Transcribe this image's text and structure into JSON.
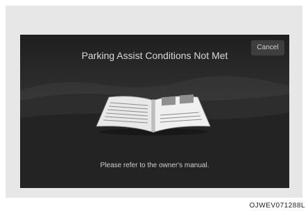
{
  "dialog": {
    "title": "Parking Assist Conditions Not Met",
    "cancel_label": "Cancel",
    "message": "Please refer to the owner's manual."
  },
  "icons": {
    "illustration": "open-book-icon"
  },
  "figure": {
    "code": "OJWEV071288L"
  },
  "colors": {
    "screen_dark": "#1f1f1f",
    "frame": "#e7e7e7",
    "text_light": "#d9d9d9"
  }
}
